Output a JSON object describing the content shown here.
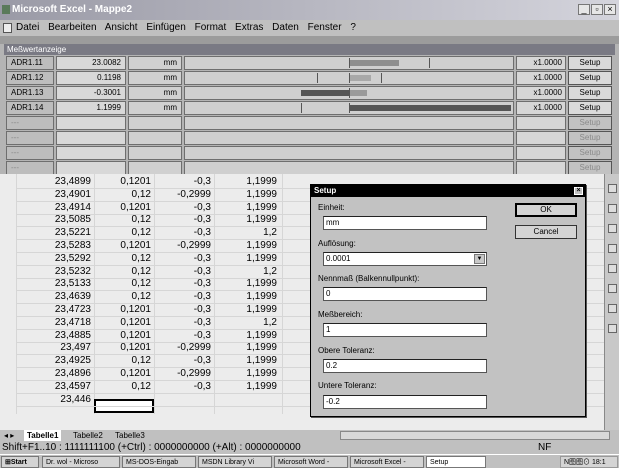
{
  "window": {
    "title": "Microsoft Excel - Mappe2"
  },
  "menu": [
    "Datei",
    "Bearbeiten",
    "Ansicht",
    "Einfügen",
    "Format",
    "Extras",
    "Daten",
    "Fenster",
    "?"
  ],
  "panel": {
    "title": "Meßwertanzeige",
    "rows": [
      {
        "name": "ADR1.11",
        "value": "23.0082",
        "unit": "mm",
        "factor": "x1.0000",
        "button": "Setup",
        "enabled": true
      },
      {
        "name": "ADR1.12",
        "value": "0.1198",
        "unit": "mm",
        "factor": "x1.0000",
        "button": "Setup",
        "enabled": true
      },
      {
        "name": "ADR1.13",
        "value": "-0.3001",
        "unit": "mm",
        "factor": "x1.0000",
        "button": "Setup",
        "enabled": true
      },
      {
        "name": "ADR1.14",
        "value": "1.1999",
        "unit": "mm",
        "factor": "x1.0000",
        "button": "Setup",
        "enabled": true
      },
      {
        "name": "---",
        "value": "",
        "unit": "",
        "factor": "",
        "button": "Setup",
        "enabled": false
      },
      {
        "name": "---",
        "value": "",
        "unit": "",
        "factor": "",
        "button": "Setup",
        "enabled": false
      },
      {
        "name": "---",
        "value": "",
        "unit": "",
        "factor": "",
        "button": "Setup",
        "enabled": false
      },
      {
        "name": "---",
        "value": "",
        "unit": "",
        "factor": "",
        "button": "Setup",
        "enabled": false
      }
    ]
  },
  "sheet": {
    "rows": [
      [
        "23,4899",
        "0,1201",
        "-0,3",
        "1,1999"
      ],
      [
        "23,4901",
        "0,12",
        "-0,2999",
        "1,1999"
      ],
      [
        "23,4914",
        "0,1201",
        "-0,3",
        "1,1999"
      ],
      [
        "23,5085",
        "0,12",
        "-0,3",
        "1,1999"
      ],
      [
        "23,5221",
        "0,12",
        "-0,3",
        "1,2"
      ],
      [
        "23,5283",
        "0,1201",
        "-0,2999",
        "1,1999"
      ],
      [
        "23,5292",
        "0,12",
        "-0,3",
        "1,1999"
      ],
      [
        "23,5232",
        "0,12",
        "-0,3",
        "1,2"
      ],
      [
        "23,5133",
        "0,12",
        "-0,3",
        "1,1999"
      ],
      [
        "23,4639",
        "0,12",
        "-0,3",
        "1,1999"
      ],
      [
        "23,4723",
        "0,1201",
        "-0,3",
        "1,1999"
      ],
      [
        "23,4718",
        "0,1201",
        "-0,3",
        "1,2"
      ],
      [
        "23,4885",
        "0,1201",
        "-0,3",
        "1,1999"
      ],
      [
        "23,497",
        "0,1201",
        "-0,2999",
        "1,1999"
      ],
      [
        "23,4925",
        "0,12",
        "-0,3",
        "1,1999"
      ],
      [
        "23,4896",
        "0,1201",
        "-0,2999",
        "1,1999"
      ],
      [
        "23,4597",
        "0,12",
        "-0,3",
        "1,1999"
      ],
      [
        "23,446",
        "",
        "",
        ""
      ]
    ]
  },
  "sheet_tabs": [
    "Tabelle1",
    "Tabelle2",
    "Tabelle3"
  ],
  "status": {
    "text": "Shift+F1..10 : 1111111100 (+Ctrl) : 0000000000 (+Alt) : 0000000000",
    "nf": "NF"
  },
  "taskbar": {
    "start": "Start",
    "tasks": [
      "Dr. wol - Microso",
      "MS-DOS-Eingab",
      "MSDN Library Vi",
      "Microsoft Word -",
      "Microsoft Excel -",
      "Setup"
    ],
    "tray": "N图图⊙ 18:1"
  },
  "dialog": {
    "title": "Setup",
    "einheit_label": "Einheit:",
    "einheit_value": "mm",
    "aufloesung_label": "Auflösung:",
    "aufloesung_value": "0.0001",
    "nennmass_label": "Nennmaß (Balkennullpunkt):",
    "nennmass_value": "0",
    "messbereich_label": "Meßbereich:",
    "messbereich_value": "1",
    "obere_label": "Obere Toleranz:",
    "obere_value": "0.2",
    "untere_label": "Untere Toleranz:",
    "untere_value": "-0.2",
    "ok": "OK",
    "cancel": "Cancel"
  }
}
